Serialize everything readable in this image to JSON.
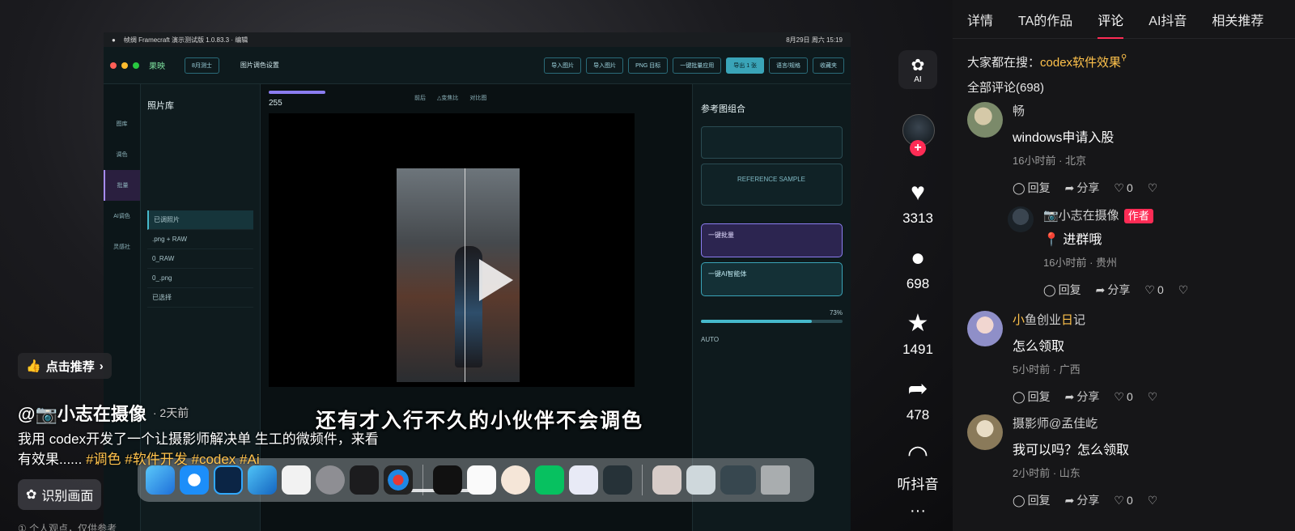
{
  "video": {
    "mac_menu": {
      "app_title": "帧绸 Framecraft 演示测试版 1.0.83.3 · 编辑",
      "datetime": "8月29日 周六  15:19"
    },
    "app": {
      "brand": "果映",
      "version_badge": "8月测士",
      "project": "图片调色设置",
      "toolbar": [
        "导入图片",
        "导入图片",
        "PNG 目标",
        "一键批量应用",
        "导出 1 张",
        "语言/规格",
        "收藏夹"
      ],
      "rail": [
        "图库",
        "调色",
        "批量",
        "AI调色",
        "灵感社"
      ],
      "library_title": "照片库",
      "library_items": [
        "已调照片",
        ".png + RAW",
        "0_RAW",
        "0_.png",
        "已选择"
      ],
      "canvas_number": "255",
      "canvas_tabs": [
        "前后",
        "△变焦比",
        "对比图"
      ],
      "right_panel_title": "参考图组合",
      "ref_sample": "REFERENCE SAMPLE",
      "grade_cards": [
        "一键批量",
        "一键AI智能体"
      ],
      "auto_label": "AUTO",
      "intensity": "73%"
    },
    "subtitle": "还有才入行不久的小伙伴不会调色",
    "recommend_label": "点击推荐",
    "author": "@📷小志在摄像",
    "posted": "2天前",
    "caption": "我用 codex开发了一个让摄影师解决单 生工的微频件，来看有效果......",
    "tags": [
      "#调色",
      "#软件开发",
      "#codex",
      "#Ai"
    ],
    "recognize_label": "识别画面",
    "personal_note": "① 个人观点，仅供参考"
  },
  "actions": {
    "ai_label": "AI",
    "likes": "3313",
    "comments": "698",
    "favorites": "1491",
    "shares": "478",
    "listen_label": "听抖音",
    "more": "···"
  },
  "panel": {
    "tabs": [
      "详情",
      "TA的作品",
      "评论",
      "AI抖音",
      "相关推荐"
    ],
    "active_tab": "评论",
    "search_prefix": "大家都在搜：",
    "search_keyword": "codex软件效果",
    "comment_total": "全部评论(698)",
    "action_labels": {
      "reply": "回复",
      "share": "分享"
    },
    "comments": [
      {
        "name": "畅",
        "text": "windows申请入股",
        "meta": "16小时前 · 北京",
        "likes": "0",
        "avatar_color": "#7b8a6a"
      },
      {
        "name": "📷小志在摄像",
        "author_badge": "作者",
        "text": "📍 进群哦",
        "meta": "16小时前 · 贵州",
        "likes": "0",
        "avatar_color": "#2a3238",
        "reply": true
      },
      {
        "name_hl": "小",
        "name_mid": "鱼创业",
        "name_hl2": "日",
        "name_rest": "记",
        "text": "怎么领取",
        "meta": "5小时前 · 广西",
        "likes": "0",
        "avatar_color": "#8f8fc8"
      },
      {
        "name": "摄影师@孟佳屹",
        "text": "我可以吗？怎么领取",
        "meta": "2小时前 · 山东",
        "likes": "0",
        "avatar_color": "#8a7a5a"
      }
    ]
  },
  "colors": {
    "accent": "#fe2c55",
    "tag": "#ffc24b",
    "panel_bg": "#161618"
  }
}
